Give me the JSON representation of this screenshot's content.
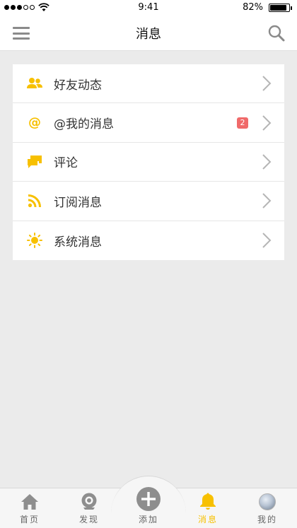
{
  "status_bar": {
    "time": "9:41",
    "battery": "82%"
  },
  "nav": {
    "title": "消息"
  },
  "list": [
    {
      "label": "好友动态",
      "icon": "friends-icon"
    },
    {
      "label": "@我的消息",
      "icon": "at-icon",
      "badge": "2"
    },
    {
      "label": "评论",
      "icon": "comment-icon"
    },
    {
      "label": "订阅消息",
      "icon": "rss-icon"
    },
    {
      "label": "系统消息",
      "icon": "sun-icon"
    }
  ],
  "at_symbol": "@",
  "tabs": [
    {
      "label": "首页",
      "icon": "home-icon"
    },
    {
      "label": "发现",
      "icon": "discover-icon"
    },
    {
      "label": "添加",
      "icon": "add-icon"
    },
    {
      "label": "消息",
      "icon": "bell-icon",
      "active": true
    },
    {
      "label": "我的",
      "icon": "avatar"
    }
  ],
  "colors": {
    "accent": "#f7c000",
    "badge": "#f06a6a",
    "background": "#ebebeb"
  }
}
